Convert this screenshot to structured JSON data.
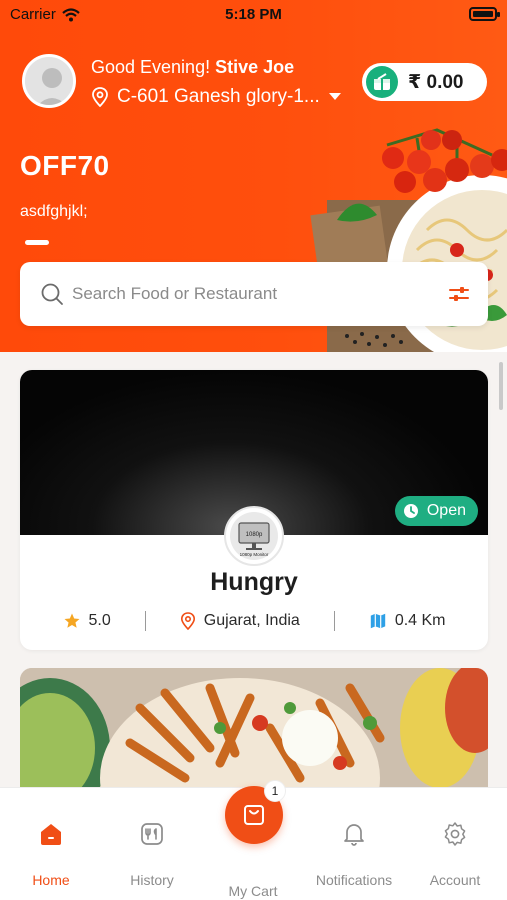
{
  "status_bar": {
    "carrier": "Carrier",
    "time": "5:18 PM"
  },
  "header": {
    "greeting_prefix": "Good Evening!",
    "user_name": "Stive Joe",
    "address": "C-601 Ganesh glory-1...",
    "wallet_amount": "₹ 0.00"
  },
  "promo": {
    "title": "OFF70",
    "subtitle": "asdfghjkl;"
  },
  "search": {
    "placeholder": "Search Food or Restaurant"
  },
  "restaurant": {
    "name": "Hungry",
    "status": "Open",
    "rating": "5.0",
    "location": "Gujarat, India",
    "distance": "0.4 Km",
    "logo_text_top": "1080p",
    "logo_text_bottom": "1080p Monitor"
  },
  "nav": {
    "home": "Home",
    "history": "History",
    "cart": "My Cart",
    "cart_count": "1",
    "notifications": "Notifications",
    "account": "Account"
  },
  "colors": {
    "primary": "#f04e16",
    "open_green": "#1fae82",
    "wallet_green": "#18b07c"
  }
}
